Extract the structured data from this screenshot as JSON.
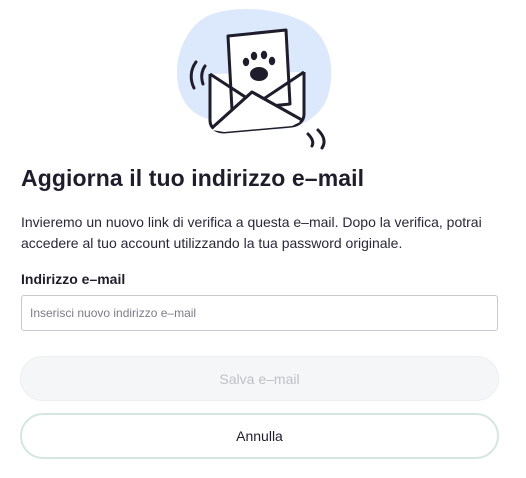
{
  "dialog": {
    "illustration_icon": "envelope-with-paw-letter-icon",
    "title": "Aggiorna il tuo indirizzo e–mail",
    "description": "Invieremo un nuovo link di verifica a questa e–mail. Dopo la verifica, potrai accedere al tuo account utilizzando la tua password originale.",
    "email": {
      "label": "Indirizzo e–mail",
      "placeholder": "Inserisci nuovo indirizzo e–mail",
      "value": ""
    },
    "save_label": "Salva e–mail",
    "cancel_label": "Annulla"
  },
  "colors": {
    "illustration_bg": "#dce8fb",
    "save_disabled_bg": "#f5f6f8",
    "save_disabled_text": "#bfc1c8",
    "cancel_border": "#d6e7e3",
    "text": "#1f1d2b"
  }
}
